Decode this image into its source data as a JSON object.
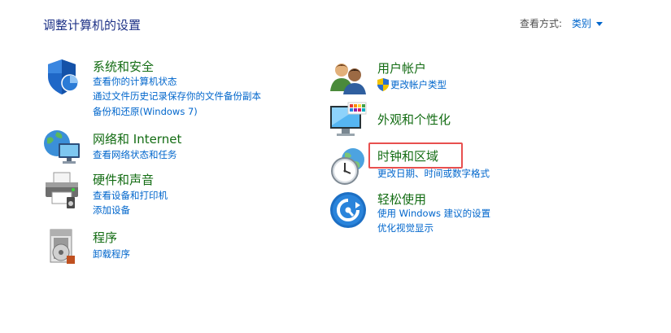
{
  "header": {
    "title": "调整计算机的设置",
    "view_by_label": "查看方式:",
    "view_by_value": "类别"
  },
  "left": [
    {
      "title": "系统和安全",
      "icon": "shield-icon",
      "links": [
        "查看你的计算机状态",
        "通过文件历史记录保存你的文件备份副本",
        "备份和还原(Windows 7)"
      ]
    },
    {
      "title": "网络和 Internet",
      "icon": "network-globe-icon",
      "links": [
        "查看网络状态和任务"
      ]
    },
    {
      "title": "硬件和声音",
      "icon": "printer-icon",
      "links": [
        "查看设备和打印机",
        "添加设备"
      ]
    },
    {
      "title": "程序",
      "icon": "programs-disk-icon",
      "links": [
        "卸载程序"
      ]
    }
  ],
  "right": [
    {
      "title": "用户帐户",
      "icon": "users-icon",
      "links": [
        "更改帐户类型"
      ],
      "link_icon": "uac-shield-icon"
    },
    {
      "title": "外观和个性化",
      "icon": "monitor-palette-icon",
      "links": []
    },
    {
      "title": "时钟和区域",
      "icon": "clock-globe-icon",
      "links": [
        "更改日期、时间或数字格式"
      ],
      "highlighted": true,
      "highlight_color": "#e8504f"
    },
    {
      "title": "轻松使用",
      "icon": "ease-of-access-icon",
      "links": [
        "使用 Windows 建议的设置",
        "优化视觉显示"
      ]
    }
  ],
  "colors": {
    "title_blue": "#1e3287",
    "category_green": "#136c13",
    "link_blue": "#0066cc"
  }
}
